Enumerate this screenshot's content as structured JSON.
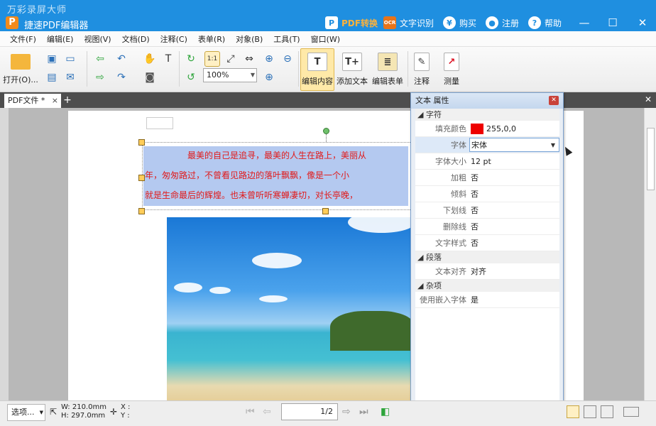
{
  "window": {
    "watermark": "万彩录屏大师",
    "title": "捷速PDF编辑器",
    "actions": {
      "pdf_convert": "PDF转换",
      "ocr": "文字识别",
      "buy": "购买",
      "register": "注册",
      "help": "帮助"
    },
    "minimize": "—",
    "maximize": "☐",
    "close": "✕"
  },
  "menu": [
    "文件(F)",
    "编辑(E)",
    "视图(V)",
    "文档(D)",
    "注释(C)",
    "表单(R)",
    "对象(B)",
    "工具(T)",
    "窗口(W)"
  ],
  "toolbar": {
    "open": "打开(O)...",
    "zoom": "100%",
    "edit_content": "编辑内容",
    "add_text": "添加文本",
    "edit_form": "编辑表单",
    "annotate": "注释",
    "measure": "测量"
  },
  "tabs": {
    "doc_tab": "PDF文件 *",
    "close": "×",
    "add": "+"
  },
  "document": {
    "lines": [
      "最美的自己是追寻，最美的人生在路上，美丽从",
      "年，匆匆路过，不曾看见路边的落叶飘飘，像是一个小",
      "就是生命最后的辉煌。也未曾听听寒蝉凄切，对长亭晚，"
    ]
  },
  "panel": {
    "title": "文本 属性",
    "categories": {
      "font": "字符",
      "paragraph": "段落",
      "misc": "杂项"
    },
    "props": {
      "fill_color": {
        "name": "填充颜色",
        "value": "255,0,0"
      },
      "font": {
        "name": "字体",
        "value": "宋体"
      },
      "size": {
        "name": "字体大小",
        "value": "12 pt"
      },
      "bold": {
        "name": "加粗",
        "value": "否"
      },
      "italic": {
        "name": "倾斜",
        "value": "否"
      },
      "underline": {
        "name": "下划线",
        "value": "否"
      },
      "strike": {
        "name": "删除线",
        "value": "否"
      },
      "text_style": {
        "name": "文字样式",
        "value": "否"
      },
      "align": {
        "name": "文本对齐",
        "value": "对齐"
      },
      "embed": {
        "name": "使用嵌入字体",
        "value": "是"
      }
    },
    "colors": {
      "swatch": "#ee0000"
    }
  },
  "status": {
    "select_mode": "选项...",
    "width": "W: 210.0mm",
    "height": "H: 297.0mm",
    "x": "X :",
    "y": "Y :",
    "page": "1/2"
  }
}
